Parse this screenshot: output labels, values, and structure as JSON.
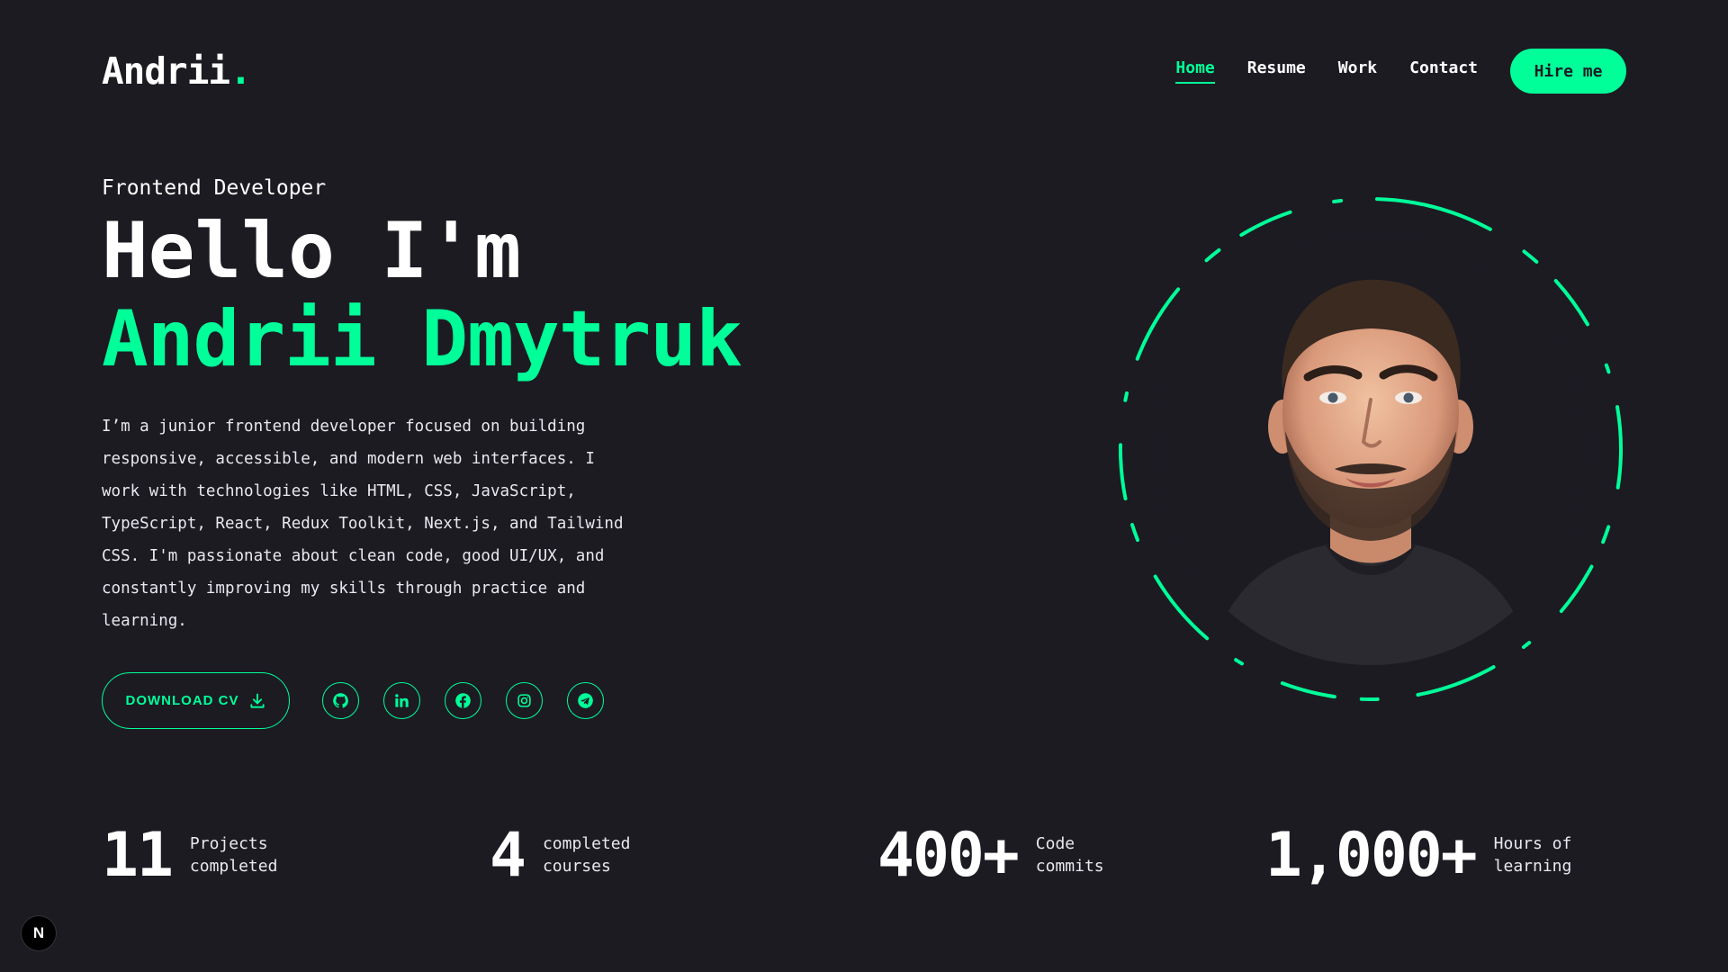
{
  "header": {
    "logo_text": "Andrii",
    "logo_dot": ".",
    "nav": [
      {
        "label": "Home",
        "active": true
      },
      {
        "label": "Resume",
        "active": false
      },
      {
        "label": "Work",
        "active": false
      },
      {
        "label": "Contact",
        "active": false
      }
    ],
    "hire_label": "Hire me"
  },
  "hero": {
    "role": "Frontend Developer",
    "greeting": "Hello I'm",
    "name": "Andrii Dmytruk",
    "bio": "I’m a junior frontend developer focused on building responsive, accessible, and modern web interfaces. I work with technologies like HTML, CSS, JavaScript, TypeScript, React, Redux Toolkit, Next.js, and Tailwind CSS. I'm passionate about clean code, good UI/UX, and constantly improving my skills through practice and learning.",
    "cv_label": "DOWNLOAD CV",
    "socials": [
      "github-icon",
      "linkedin-icon",
      "facebook-icon",
      "instagram-icon",
      "telegram-icon"
    ]
  },
  "stats": [
    {
      "value": "11",
      "label": "Projects completed"
    },
    {
      "value": "4",
      "label": "completed courses"
    },
    {
      "value": "400+",
      "label": "Code commits"
    },
    {
      "value": "1,000+",
      "label": "Hours of learning"
    }
  ],
  "badge": "N",
  "colors": {
    "accent": "#00ff99",
    "background": "#1c1b22",
    "text": "#ffffff"
  }
}
